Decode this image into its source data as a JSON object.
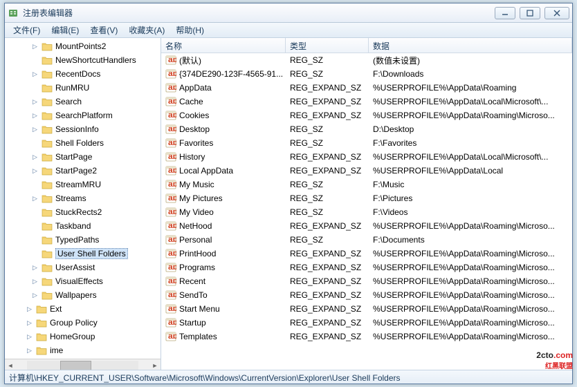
{
  "window": {
    "title": "注册表编辑器"
  },
  "menus": [
    {
      "label": "文件(F)"
    },
    {
      "label": "编辑(E)"
    },
    {
      "label": "查看(V)"
    },
    {
      "label": "收藏夹(A)"
    },
    {
      "label": "帮助(H)"
    }
  ],
  "tree": [
    {
      "label": "MountPoints2",
      "expander": "▷",
      "level": 3
    },
    {
      "label": "NewShortcutHandlers",
      "expander": "",
      "level": 3
    },
    {
      "label": "RecentDocs",
      "expander": "▷",
      "level": 3
    },
    {
      "label": "RunMRU",
      "expander": "",
      "level": 3
    },
    {
      "label": "Search",
      "expander": "▷",
      "level": 3
    },
    {
      "label": "SearchPlatform",
      "expander": "▷",
      "level": 3
    },
    {
      "label": "SessionInfo",
      "expander": "▷",
      "level": 3
    },
    {
      "label": "Shell Folders",
      "expander": "",
      "level": 3
    },
    {
      "label": "StartPage",
      "expander": "▷",
      "level": 3
    },
    {
      "label": "StartPage2",
      "expander": "▷",
      "level": 3
    },
    {
      "label": "StreamMRU",
      "expander": "",
      "level": 3
    },
    {
      "label": "Streams",
      "expander": "▷",
      "level": 3
    },
    {
      "label": "StuckRects2",
      "expander": "",
      "level": 3
    },
    {
      "label": "Taskband",
      "expander": "",
      "level": 3
    },
    {
      "label": "TypedPaths",
      "expander": "",
      "level": 3
    },
    {
      "label": "User Shell Folders",
      "expander": "",
      "level": 3,
      "selected": true
    },
    {
      "label": "UserAssist",
      "expander": "▷",
      "level": 3
    },
    {
      "label": "VisualEffects",
      "expander": "▷",
      "level": 3
    },
    {
      "label": "Wallpapers",
      "expander": "▷",
      "level": 3
    },
    {
      "label": "Ext",
      "expander": "▷",
      "level": 2
    },
    {
      "label": "Group Policy",
      "expander": "▷",
      "level": 2
    },
    {
      "label": "HomeGroup",
      "expander": "▷",
      "level": 2
    },
    {
      "label": "ime",
      "expander": "▷",
      "level": 2
    }
  ],
  "columns": {
    "name": "名称",
    "type": "类型",
    "data": "数据"
  },
  "rows": [
    {
      "name": "(默认)",
      "type": "REG_SZ",
      "data": "(数值未设置)"
    },
    {
      "name": "{374DE290-123F-4565-91...",
      "type": "REG_SZ",
      "data": "F:\\Downloads"
    },
    {
      "name": "AppData",
      "type": "REG_EXPAND_SZ",
      "data": "%USERPROFILE%\\AppData\\Roaming"
    },
    {
      "name": "Cache",
      "type": "REG_EXPAND_SZ",
      "data": "%USERPROFILE%\\AppData\\Local\\Microsoft\\..."
    },
    {
      "name": "Cookies",
      "type": "REG_EXPAND_SZ",
      "data": "%USERPROFILE%\\AppData\\Roaming\\Microso..."
    },
    {
      "name": "Desktop",
      "type": "REG_SZ",
      "data": "D:\\Desktop"
    },
    {
      "name": "Favorites",
      "type": "REG_SZ",
      "data": "F:\\Favorites"
    },
    {
      "name": "History",
      "type": "REG_EXPAND_SZ",
      "data": "%USERPROFILE%\\AppData\\Local\\Microsoft\\..."
    },
    {
      "name": "Local AppData",
      "type": "REG_EXPAND_SZ",
      "data": "%USERPROFILE%\\AppData\\Local"
    },
    {
      "name": "My Music",
      "type": "REG_SZ",
      "data": "F:\\Music"
    },
    {
      "name": "My Pictures",
      "type": "REG_SZ",
      "data": "F:\\Pictures"
    },
    {
      "name": "My Video",
      "type": "REG_SZ",
      "data": "F:\\Videos"
    },
    {
      "name": "NetHood",
      "type": "REG_EXPAND_SZ",
      "data": "%USERPROFILE%\\AppData\\Roaming\\Microso..."
    },
    {
      "name": "Personal",
      "type": "REG_SZ",
      "data": "F:\\Documents"
    },
    {
      "name": "PrintHood",
      "type": "REG_EXPAND_SZ",
      "data": "%USERPROFILE%\\AppData\\Roaming\\Microso..."
    },
    {
      "name": "Programs",
      "type": "REG_EXPAND_SZ",
      "data": "%USERPROFILE%\\AppData\\Roaming\\Microso..."
    },
    {
      "name": "Recent",
      "type": "REG_EXPAND_SZ",
      "data": "%USERPROFILE%\\AppData\\Roaming\\Microso..."
    },
    {
      "name": "SendTo",
      "type": "REG_EXPAND_SZ",
      "data": "%USERPROFILE%\\AppData\\Roaming\\Microso..."
    },
    {
      "name": "Start Menu",
      "type": "REG_EXPAND_SZ",
      "data": "%USERPROFILE%\\AppData\\Roaming\\Microso..."
    },
    {
      "name": "Startup",
      "type": "REG_EXPAND_SZ",
      "data": "%USERPROFILE%\\AppData\\Roaming\\Microso..."
    },
    {
      "name": "Templates",
      "type": "REG_EXPAND_SZ",
      "data": "%USERPROFILE%\\AppData\\Roaming\\Microso..."
    }
  ],
  "status": "计算机\\HKEY_CURRENT_USER\\Software\\Microsoft\\Windows\\CurrentVersion\\Explorer\\User Shell Folders",
  "watermark": {
    "left": "2cto",
    "right": ".com",
    "tag": "红黑联盟"
  }
}
